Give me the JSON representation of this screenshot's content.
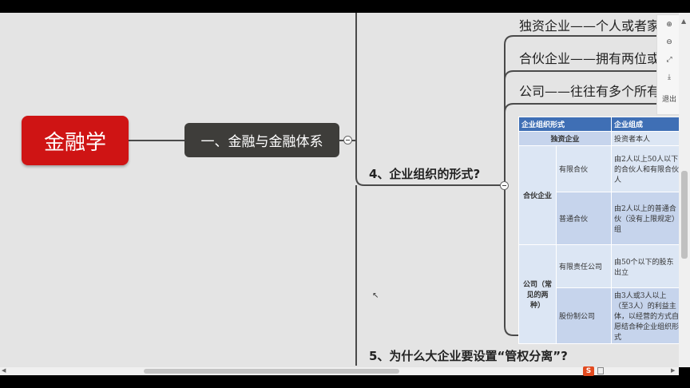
{
  "mindmap": {
    "root": "金融学",
    "topic": "一、金融与金融体系",
    "branch_4": "4、企业组织的形式?",
    "branch_5": "5、为什么大企业要设置“管权分离”?",
    "sub_items": [
      "独资企业——个人或者家庭所有",
      "合伙企业——拥有两位或更多所",
      "公司——往往有多个所有者"
    ]
  },
  "table": {
    "headers": [
      "企业组织形式",
      "企业组成"
    ],
    "sole": {
      "label": "独资企业",
      "desc": "投资者本人"
    },
    "partnership": {
      "label": "合伙企业",
      "rows": [
        {
          "sub": "有限合伙",
          "desc": "由2人以上50人以下的合伙人和有限合伙人"
        },
        {
          "sub": "普通合伙",
          "desc": "由2人以上的普通合伙（没有上限规定）组"
        }
      ]
    },
    "company": {
      "label": "公司（常见的两种）",
      "rows": [
        {
          "sub": "有限责任公司",
          "desc": "由50个以下的股东出立"
        },
        {
          "sub": "股份制公司",
          "desc": "由3人或3人以上（至3人）的利益主体，以经营的方式自愿结合种企业组织形式"
        }
      ]
    }
  },
  "toolbar": {
    "zoom_in": "zoom-in-icon",
    "zoom_out": "zoom-out-icon",
    "fit": "fit-icon",
    "download": "download-icon",
    "exit_label": "退出"
  },
  "colors": {
    "root": "#cf1414",
    "topic": "#3e3d3a",
    "table_header": "#3f6fb5",
    "canvas": "#e4e4e4"
  }
}
